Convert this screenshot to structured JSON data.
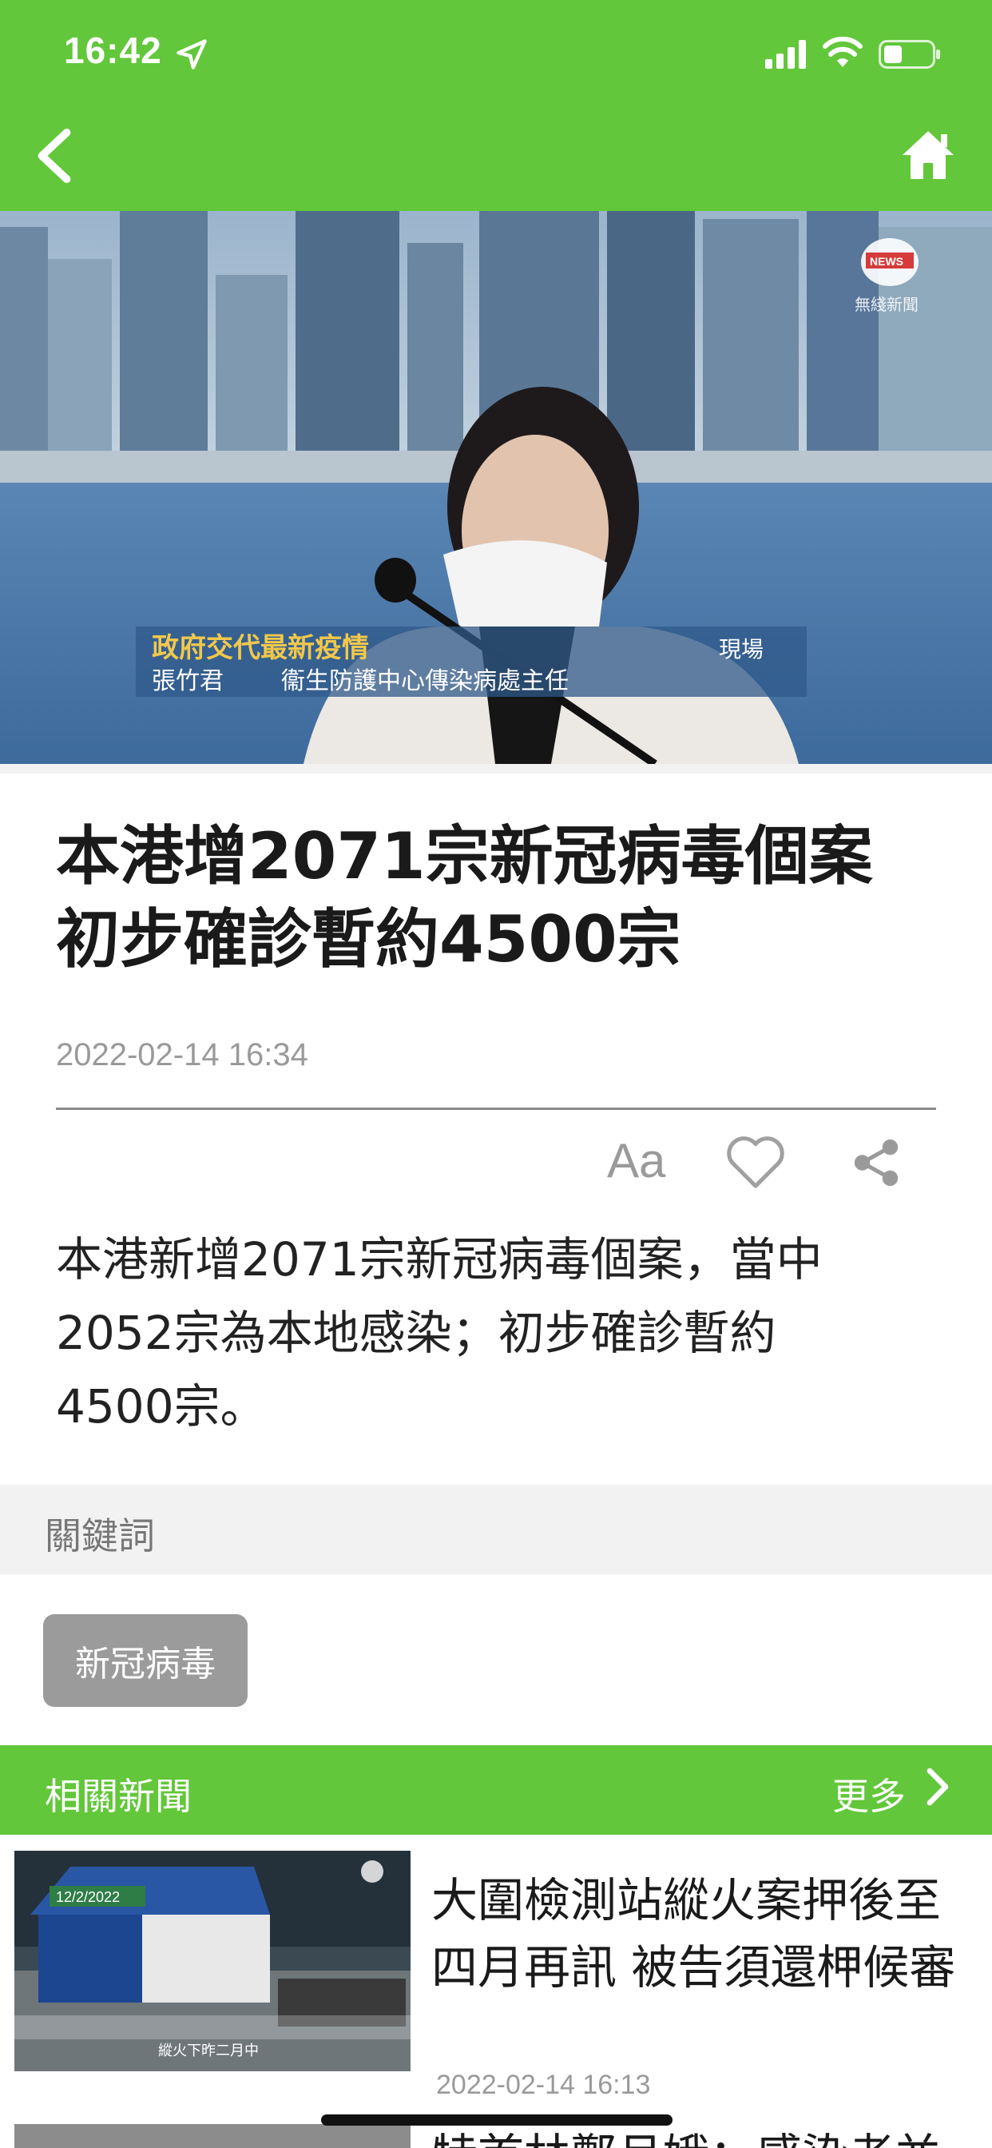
{
  "status_bar": {
    "time": "16:42"
  },
  "header": {
    "back_icon": "chevron-left-icon",
    "home_icon": "home-icon",
    "background": "#62c73a"
  },
  "hero": {
    "caption_title": "政府交代最新疫情",
    "caption_tag": "現場",
    "caption_name": "張竹君",
    "caption_role": "衞生防護中心傳染病處主任",
    "logo_text": "NEWS",
    "logo_sub": "無綫新聞"
  },
  "article": {
    "headline_line1": "本港增2071宗新冠病毒個案",
    "headline_line2": "初步確診暫約4500宗",
    "date": "2022-02-14 16:34",
    "font_size_label": "Aa",
    "body_line1": "本港新增2071宗新冠病毒個案，當中",
    "body_line2": "2052宗為本地感染；初步確診暫約",
    "body_line3": "4500宗。"
  },
  "keywords": {
    "title": "關鍵詞",
    "tags": [
      "新冠病毒"
    ]
  },
  "related": {
    "title": "相關新聞",
    "more_label": "更多",
    "items": [
      {
        "headline_line1": "大圍檢測站縱火案押後至",
        "headline_line2": "四月再訊 被告須還柙候審",
        "date": "2022-02-14 16:13",
        "thumb_date": "12/2/2022",
        "thumb_caption": "縱火下昨二月中"
      },
      {
        "headline_line1": "特首林鄭月娥：感染者並不必然需要住院"
      }
    ]
  },
  "colors": {
    "accent": "#62c73a",
    "tag_bg": "#9b9b9b",
    "muted": "#9a9a9a"
  }
}
